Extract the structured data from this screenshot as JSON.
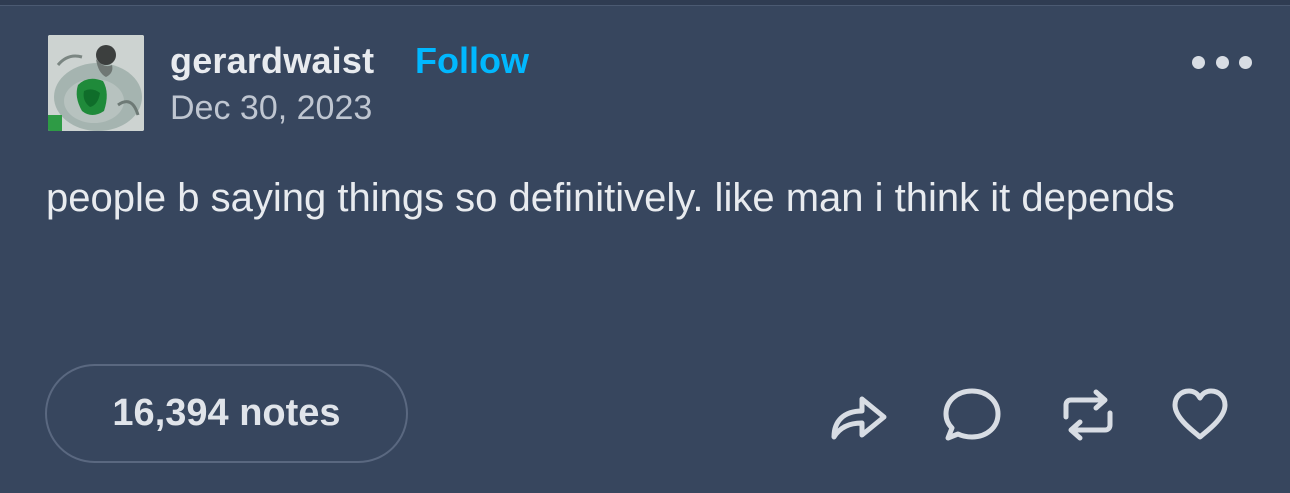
{
  "post": {
    "username": "gerardwaist",
    "follow_label": "Follow",
    "date": "Dec 30, 2023",
    "text": "people b saying things so definitively. like man i think it depends",
    "notes_label": "16,394 notes"
  },
  "icons": {
    "more": "ellipsis-icon",
    "share": "share-arrow-icon",
    "reply": "reply-bubble-icon",
    "reblog": "reblog-icon",
    "like": "heart-icon"
  },
  "colors": {
    "background": "#37465e",
    "follow": "#00b8ff",
    "text": "#e8ebef"
  }
}
